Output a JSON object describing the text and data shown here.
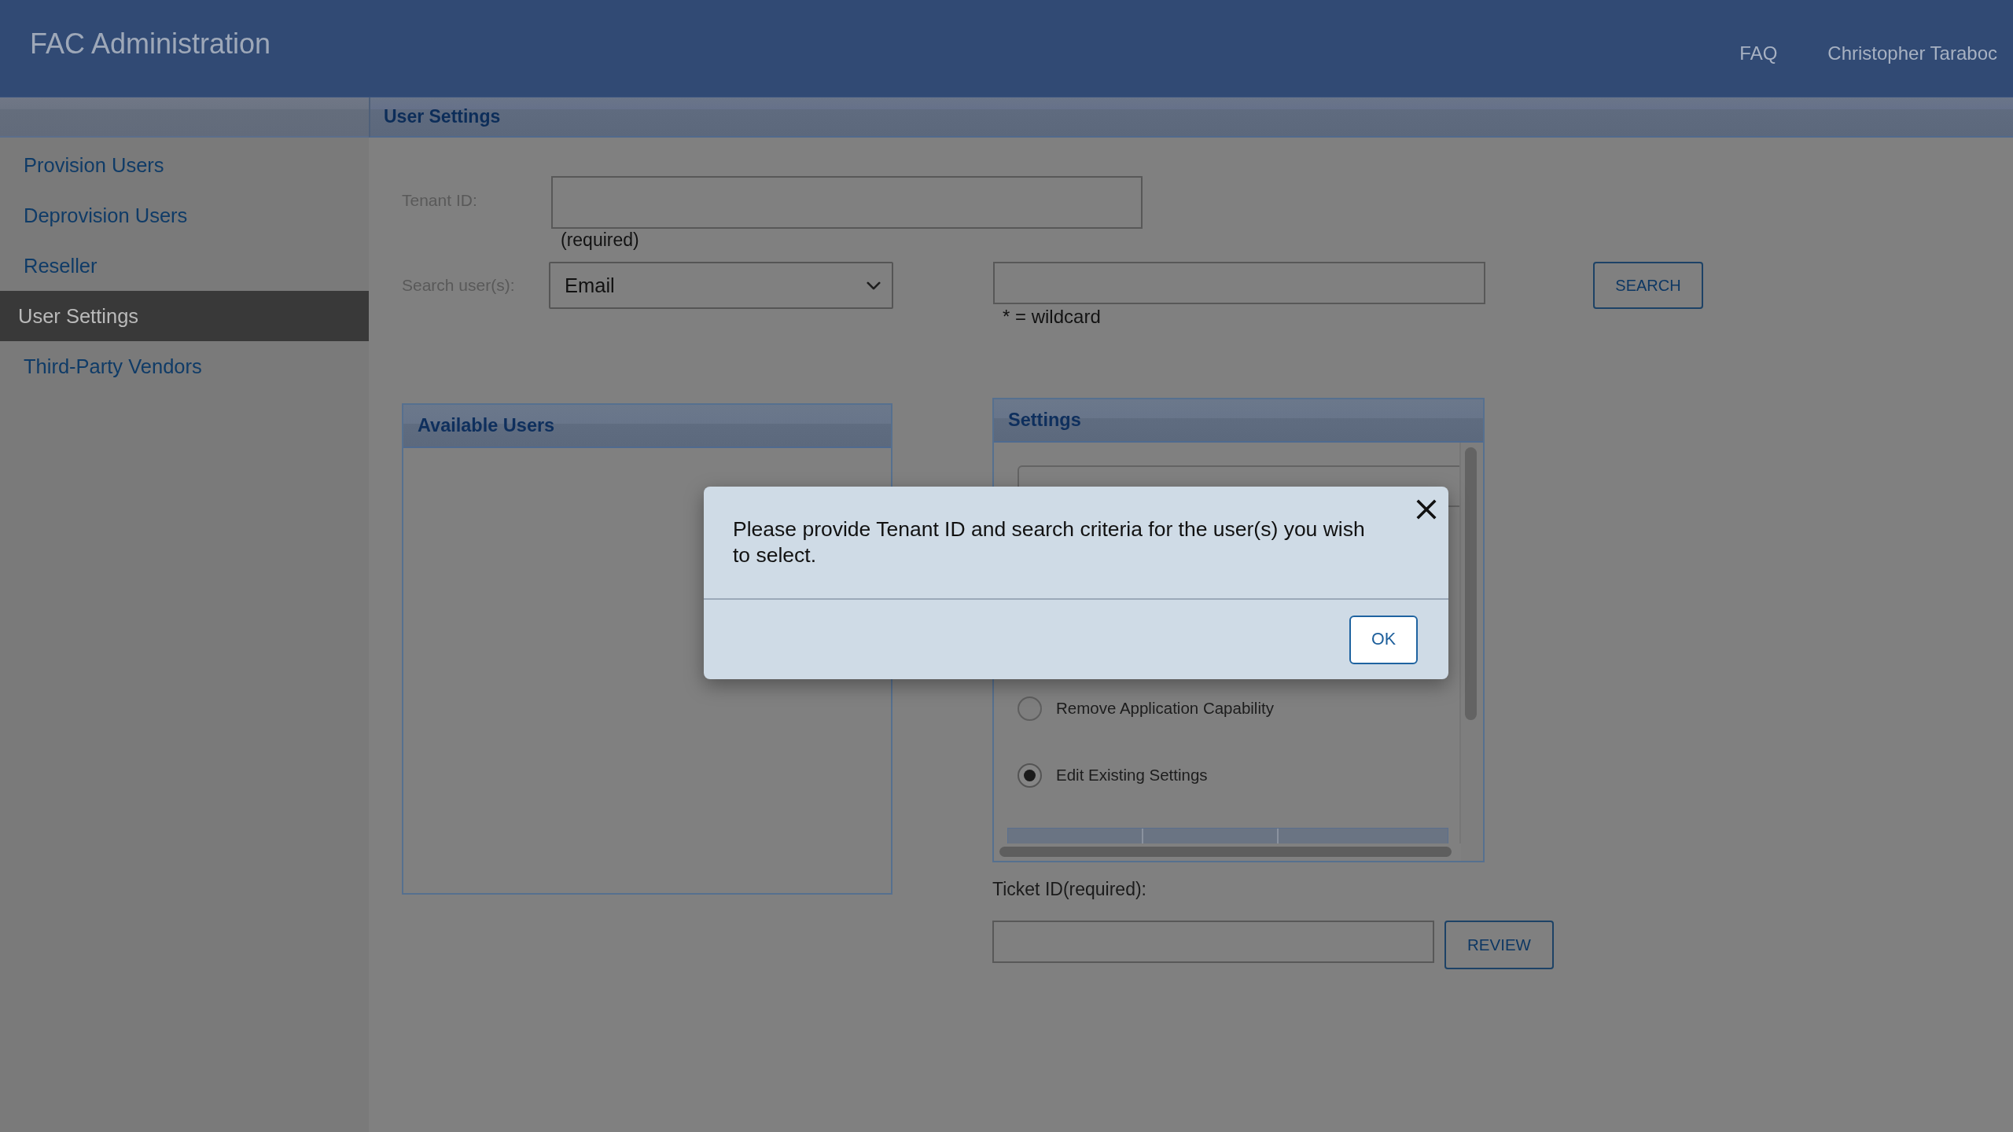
{
  "header": {
    "title": "FAC Administration",
    "links": [
      {
        "label": "FAQ"
      }
    ],
    "user": "Christopher Taraboc"
  },
  "sidebar": {
    "items": [
      {
        "label": "Provision Users",
        "selected": false
      },
      {
        "label": "Deprovision Users",
        "selected": false
      },
      {
        "label": "Reseller",
        "selected": false
      },
      {
        "label": "User Settings",
        "selected": true
      },
      {
        "label": "Third-Party Vendors",
        "selected": false
      }
    ]
  },
  "page_title": "User Settings",
  "form": {
    "tenant_label": "Tenant ID:",
    "tenant_hint": "(required)",
    "search_label": "Search user(s):",
    "search_by": "Email",
    "search_hint": "* = wildcard",
    "search_button": "SEARCH"
  },
  "available_users": {
    "title": "Available Users"
  },
  "settings": {
    "title": "Settings",
    "options": [
      {
        "label": "Remove Application Capability",
        "selected": false
      },
      {
        "label": "Edit Existing Settings",
        "selected": true
      }
    ]
  },
  "ticket": {
    "label": "Ticket ID(required):",
    "button": "REVIEW"
  },
  "dialog": {
    "message": "Please provide Tenant ID and search criteria for the user(s) you wish to select.",
    "button": "OK"
  }
}
